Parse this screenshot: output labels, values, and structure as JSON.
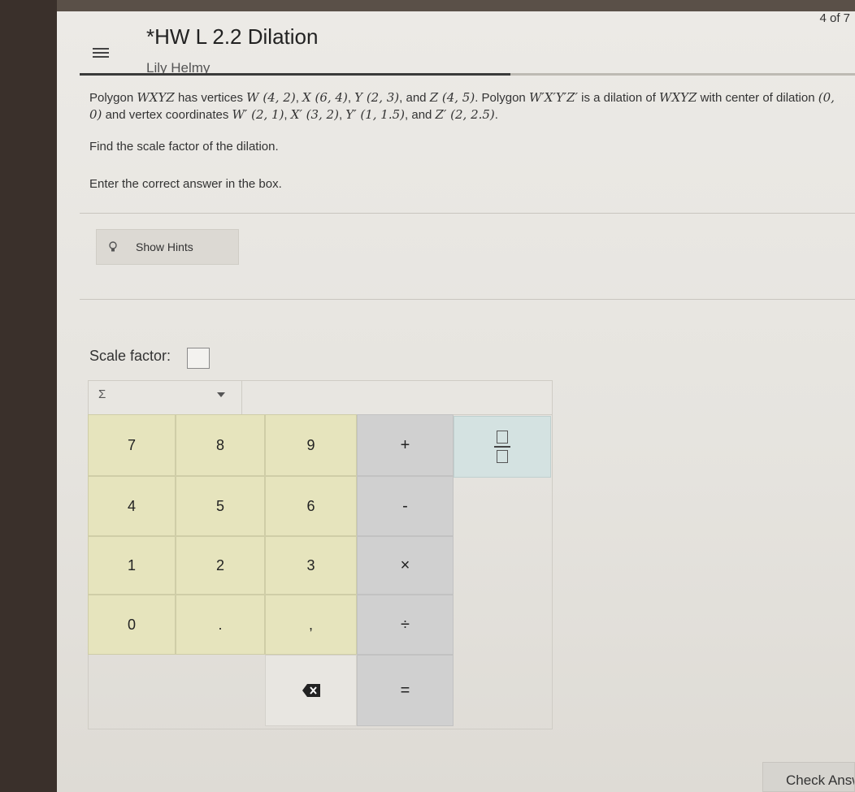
{
  "header": {
    "counter": "4 of 7",
    "title": "*HW L 2.2 Dilation",
    "student": "Lily Helmy"
  },
  "question": {
    "lead": "Polygon ",
    "poly": "WXYZ",
    "has_vertices": " has vertices ",
    "w": "W (4, 2)",
    "sep1": ", ",
    "x": "X (6, 4)",
    "sep2": ", ",
    "y": "Y (2, 3)",
    "and1": ", and ",
    "z": "Z (4, 5)",
    "polygon_word": ". Polygon ",
    "poly_prime": "W′X′Y′Z′",
    "is_dilation": " is a dilation of ",
    "poly2": "WXYZ",
    "with_center": " with center of dilation ",
    "center": "(0, 0)",
    "and_vertex": " and vertex coordinates ",
    "w_prime": "W′ (2, 1)",
    "sep3": ", ",
    "x_prime": "X′ (3, 2)",
    "sep4": ", ",
    "y_prime": "Y′ (1, 1.5)",
    "and2": ", and ",
    "z_prime": "Z′ (2, 2.5)",
    "end": "."
  },
  "prompt": "Find the scale factor of the dilation.",
  "instruction": "Enter the correct answer in the box.",
  "hints_button": "Show Hints",
  "scale_label": "Scale factor:",
  "answer_value": "",
  "keypad": {
    "sigma": "Σ",
    "k7": "7",
    "k8": "8",
    "k9": "9",
    "plus": "+",
    "k4": "4",
    "k5": "5",
    "k6": "6",
    "minus": "-",
    "k1": "1",
    "k2": "2",
    "k3": "3",
    "times": "×",
    "k0": "0",
    "dot": ".",
    "comma": ",",
    "divide": "÷",
    "equals": "="
  },
  "check_button": "Check Answer",
  "colors": {
    "number_key": "#e6e4bd",
    "operator_key": "#d0d0d0",
    "fraction_key": "#d4e2e1",
    "background": "#eceae6"
  }
}
